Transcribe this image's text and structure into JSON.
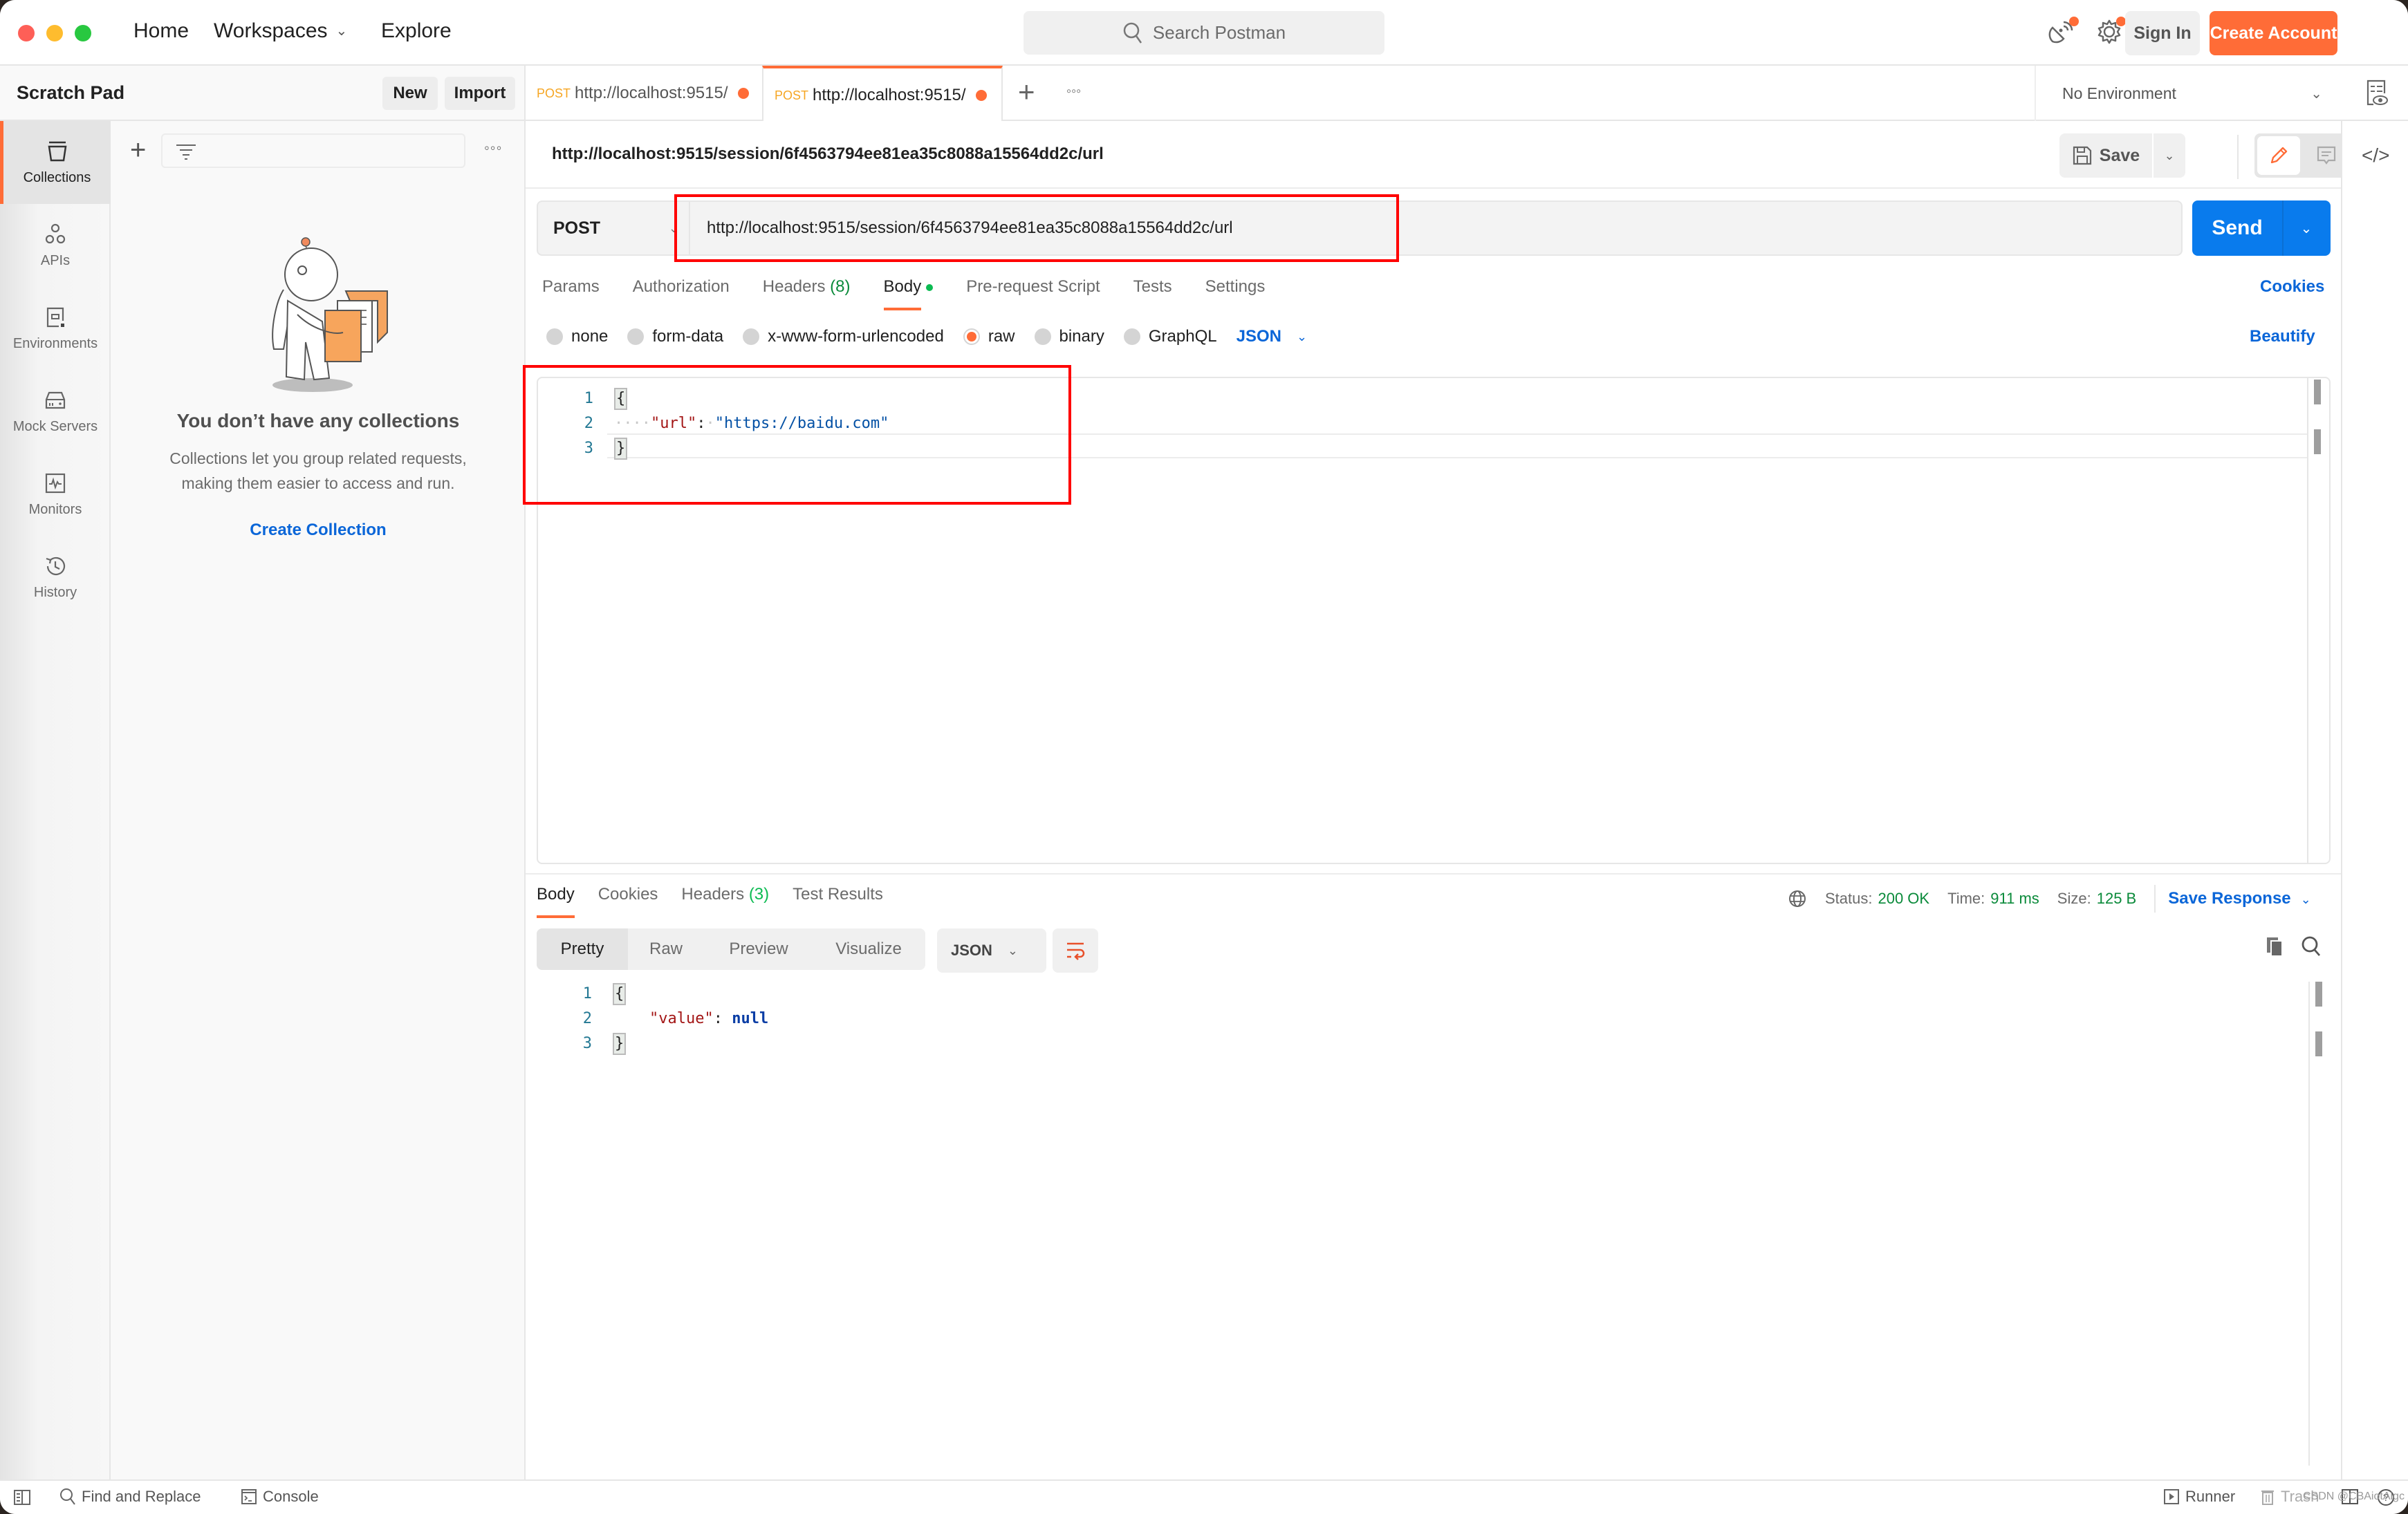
{
  "header": {
    "nav": [
      {
        "label": "Home"
      },
      {
        "label": "Workspaces",
        "has_dropdown": true
      },
      {
        "label": "Explore"
      }
    ],
    "search_placeholder": "Search Postman",
    "icons": [
      "satellite-icon",
      "settings-icon"
    ],
    "sign_in_label": "Sign In",
    "create_account_label": "Create Account",
    "accent_color": "#ff6c37"
  },
  "workspace": {
    "title": "Scratch Pad",
    "new_label": "New",
    "import_label": "Import"
  },
  "sidebar": {
    "items": [
      {
        "label": "Collections",
        "icon": "collections-icon",
        "active": true
      },
      {
        "label": "APIs",
        "icon": "apis-icon",
        "active": false
      },
      {
        "label": "Environments",
        "icon": "environments-icon",
        "active": false
      },
      {
        "label": "Mock Servers",
        "icon": "mock-servers-icon",
        "active": false
      },
      {
        "label": "Monitors",
        "icon": "monitors-icon",
        "active": false
      },
      {
        "label": "History",
        "icon": "history-icon",
        "active": false
      }
    ]
  },
  "collections_panel": {
    "empty_title": "You don’t have any collections",
    "empty_desc_line1": "Collections let you group related requests,",
    "empty_desc_line2": "making them easier to access and run.",
    "create_label": "Create Collection"
  },
  "tabs": [
    {
      "method": "POST",
      "label": "http://localhost:9515/",
      "unsaved": true,
      "active": false
    },
    {
      "method": "POST",
      "label": "http://localhost:9515/",
      "unsaved": true,
      "active": true
    }
  ],
  "environment": {
    "selected": "No Environment"
  },
  "request": {
    "title": "http://localhost:9515/session/6f4563794ee81ea35c8088a15564dd2c/url",
    "save_label": "Save",
    "method": "POST",
    "url": "http://localhost:9515/session/6f4563794ee81ea35c8088a15564dd2c/url",
    "send_label": "Send",
    "tabs": [
      {
        "label": "Params"
      },
      {
        "label": "Authorization"
      },
      {
        "label": "Headers",
        "count": "(8)"
      },
      {
        "label": "Body",
        "active": true,
        "indicator": true
      },
      {
        "label": "Pre-request Script"
      },
      {
        "label": "Tests"
      },
      {
        "label": "Settings"
      }
    ],
    "cookies_label": "Cookies",
    "body_modes": [
      {
        "label": "none",
        "selected": false
      },
      {
        "label": "form-data",
        "selected": false
      },
      {
        "label": "x-www-form-urlencoded",
        "selected": false
      },
      {
        "label": "raw",
        "selected": true
      },
      {
        "label": "binary",
        "selected": false
      },
      {
        "label": "GraphQL",
        "selected": false
      }
    ],
    "raw_language": "JSON",
    "beautify_label": "Beautify",
    "body_lines": [
      {
        "num": "1",
        "text": "{"
      },
      {
        "num": "2",
        "key": "\"url\"",
        "value": "\"https://baidu.com\""
      },
      {
        "num": "3",
        "text": "}"
      }
    ]
  },
  "response": {
    "tabs": [
      {
        "label": "Body",
        "active": true
      },
      {
        "label": "Cookies"
      },
      {
        "label": "Headers",
        "count": "(3)"
      },
      {
        "label": "Test Results"
      }
    ],
    "status_label": "Status:",
    "status": "200 OK",
    "time_label": "Time:",
    "time": "911 ms",
    "size_label": "Size:",
    "size": "125 B",
    "save_response_label": "Save Response",
    "views": [
      {
        "label": "Pretty",
        "active": true
      },
      {
        "label": "Raw"
      },
      {
        "label": "Preview"
      },
      {
        "label": "Visualize"
      }
    ],
    "format": "JSON",
    "body_lines": [
      {
        "num": "1",
        "text": "{"
      },
      {
        "num": "2",
        "key": "\"value\"",
        "value": "null"
      },
      {
        "num": "3",
        "text": "}"
      }
    ]
  },
  "footer": {
    "find_replace_label": "Find and Replace",
    "console_label": "Console",
    "runner_label": "Runner",
    "trash_label": "Trash",
    "watermark": "CSDN @CBAiotAigc"
  }
}
